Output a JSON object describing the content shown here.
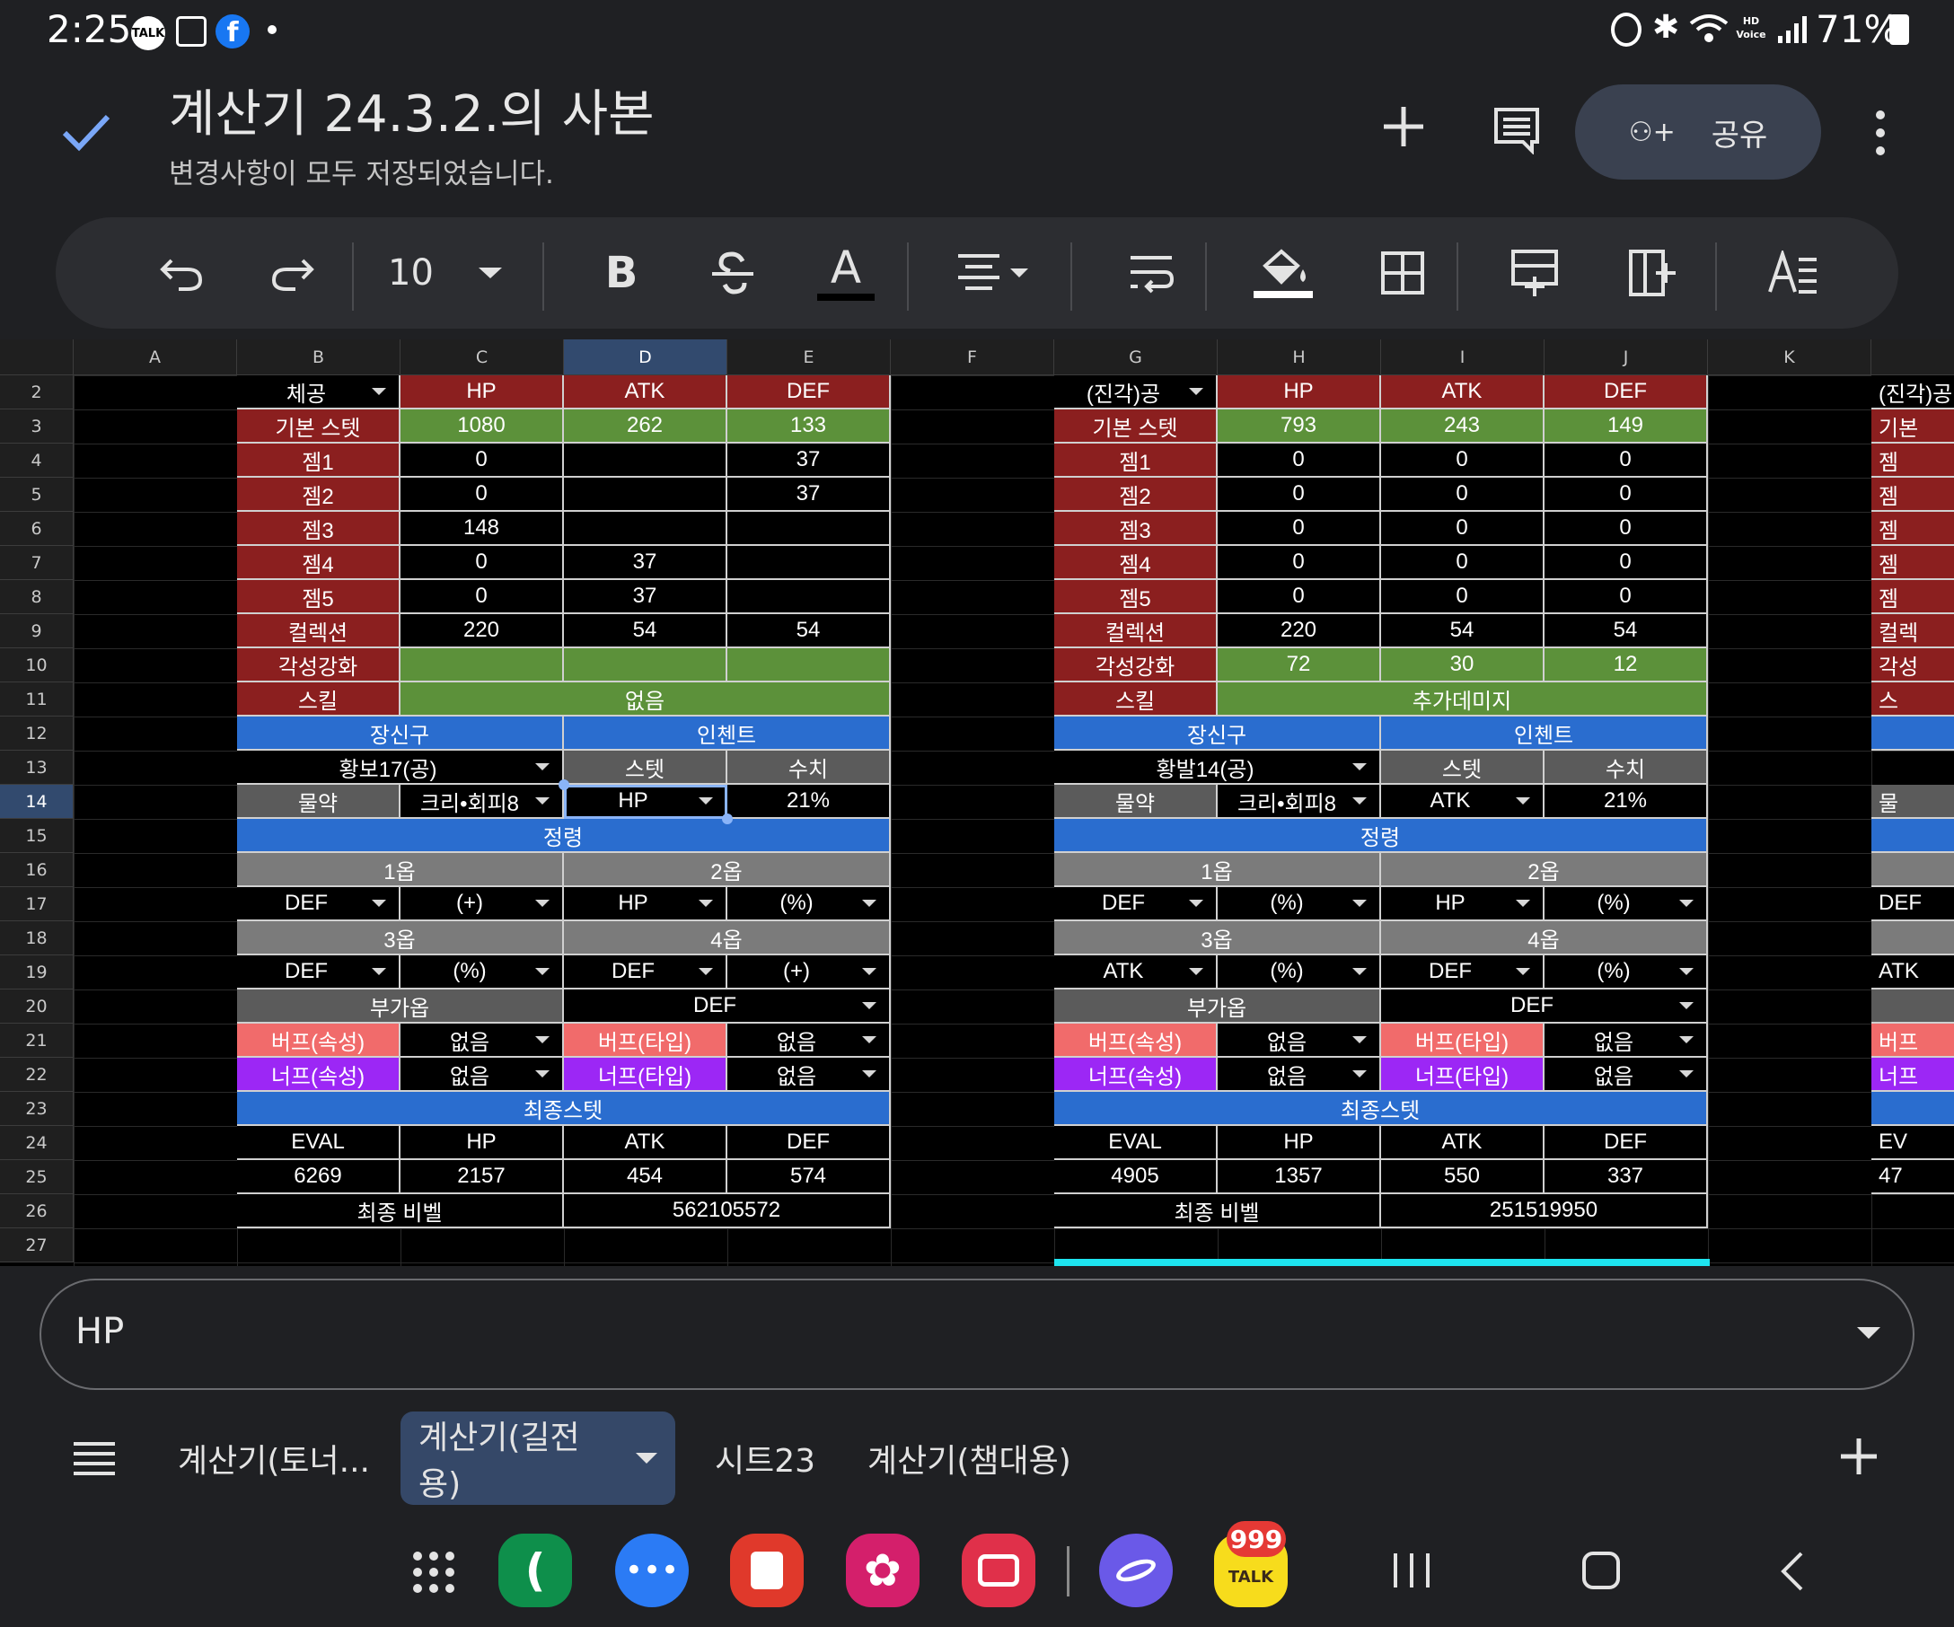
{
  "status": {
    "time": "2:25",
    "talk_badge": "TALK",
    "battery": "71%",
    "hd_voice": "HD Voice"
  },
  "header": {
    "title": "계산기 24.3.2.의 사본",
    "subtitle": "변경사항이 모두 저장되었습니다.",
    "share_label": "공유"
  },
  "toolbar": {
    "font_size": "10"
  },
  "columns": [
    "A",
    "B",
    "C",
    "D",
    "E",
    "F",
    "G",
    "H",
    "I",
    "J",
    "K"
  ],
  "rows": [
    "2",
    "3",
    "4",
    "5",
    "6",
    "7",
    "8",
    "9",
    "10",
    "11",
    "12",
    "13",
    "14",
    "15",
    "16",
    "17",
    "18",
    "19",
    "20",
    "21",
    "22",
    "23",
    "24",
    "25",
    "26",
    "27"
  ],
  "left": {
    "b2": "체공",
    "hp": "HP",
    "atk": "ATK",
    "def": "DEF",
    "base_label": "기본 스텟",
    "base": [
      "1080",
      "262",
      "133"
    ],
    "gems": [
      {
        "label": "젬1",
        "v": [
          "0",
          "",
          "37"
        ]
      },
      {
        "label": "젬2",
        "v": [
          "0",
          "",
          "37"
        ]
      },
      {
        "label": "젬3",
        "v": [
          "148",
          "",
          ""
        ]
      },
      {
        "label": "젬4",
        "v": [
          "0",
          "37",
          ""
        ]
      },
      {
        "label": "젬5",
        "v": [
          "0",
          "37",
          ""
        ]
      }
    ],
    "coll_label": "컬렉션",
    "coll": [
      "220",
      "54",
      "54"
    ],
    "awk_label": "각성강화",
    "awk": [
      "",
      "",
      ""
    ],
    "skill_label": "스킬",
    "skill": "없음",
    "accessory_label": "장신구",
    "enchant_label": "인첸트",
    "accessory": "황보17(공)",
    "stat_label": "스텟",
    "value_label": "수치",
    "potion_label": "물약",
    "potion": "크리•회피8",
    "enchant_stat": "HP",
    "enchant_value": "21%",
    "spirit_label": "정령",
    "opt1": "1옵",
    "opt2": "2옵",
    "opt3": "3옵",
    "opt4": "4옵",
    "r17": [
      "DEF",
      "(+)",
      "HP",
      "(%)"
    ],
    "r19": [
      "DEF",
      "(%)",
      "DEF",
      "(+)"
    ],
    "extra_label": "부가옵",
    "extra": "DEF",
    "buff_attr": "버프(속성)",
    "buff_attr_v": "없음",
    "buff_type": "버프(타입)",
    "buff_type_v": "없음",
    "nerf_attr": "너프(속성)",
    "nerf_attr_v": "없음",
    "nerf_type": "너프(타입)",
    "nerf_type_v": "없음",
    "final_label": "최종스텟",
    "eval": "EVAL",
    "final": [
      "6269",
      "2157",
      "454",
      "574"
    ],
    "ratio_label": "최종 비벨",
    "ratio": "562105572"
  },
  "right": {
    "b2": "(진각)공",
    "hp": "HP",
    "atk": "ATK",
    "def": "DEF",
    "base_label": "기본 스텟",
    "base": [
      "793",
      "243",
      "149"
    ],
    "gems": [
      {
        "label": "젬1",
        "v": [
          "0",
          "0",
          "0"
        ]
      },
      {
        "label": "젬2",
        "v": [
          "0",
          "0",
          "0"
        ]
      },
      {
        "label": "젬3",
        "v": [
          "0",
          "0",
          "0"
        ]
      },
      {
        "label": "젬4",
        "v": [
          "0",
          "0",
          "0"
        ]
      },
      {
        "label": "젬5",
        "v": [
          "0",
          "0",
          "0"
        ]
      }
    ],
    "coll_label": "컬렉션",
    "coll": [
      "220",
      "54",
      "54"
    ],
    "awk_label": "각성강화",
    "awk": [
      "72",
      "30",
      "12"
    ],
    "skill_label": "스킬",
    "skill": "추가데미지",
    "accessory_label": "장신구",
    "enchant_label": "인첸트",
    "accessory": "황발14(공)",
    "stat_label": "스텟",
    "value_label": "수치",
    "potion_label": "물약",
    "potion": "크리•회피8",
    "enchant_stat": "ATK",
    "enchant_value": "21%",
    "spirit_label": "정령",
    "opt1": "1옵",
    "opt2": "2옵",
    "opt3": "3옵",
    "opt4": "4옵",
    "r17": [
      "DEF",
      "(%)",
      "HP",
      "(%)"
    ],
    "r19": [
      "ATK",
      "(%)",
      "DEF",
      "(%)"
    ],
    "extra_label": "부가옵",
    "extra": "DEF",
    "buff_attr": "버프(속성)",
    "buff_attr_v": "없음",
    "buff_type": "버프(타입)",
    "buff_type_v": "없음",
    "nerf_attr": "너프(속성)",
    "nerf_attr_v": "없음",
    "nerf_type": "너프(타입)",
    "nerf_type_v": "없음",
    "final_label": "최종스텟",
    "eval": "EVAL",
    "final": [
      "4905",
      "1357",
      "550",
      "337"
    ],
    "ratio_label": "최종 비벨",
    "ratio": "251519950"
  },
  "partial": {
    "b2": "(진각)공",
    "base_label": "기본",
    "gem": "젬",
    "coll": "컬렉",
    "awk": "각성",
    "skill": "스",
    "potion": "물",
    "r17": "DEF",
    "r19": "ATK",
    "buff": "버프",
    "nerf": "너프",
    "eval": "EV",
    "final": "47"
  },
  "formula": {
    "value": "HP"
  },
  "tabs": [
    "계산기(토너...",
    "계산기(길전용)",
    "시트23",
    "계산기(챔대용)"
  ],
  "dock": {
    "kakao_count": "999",
    "kakao_label": "TALK"
  }
}
